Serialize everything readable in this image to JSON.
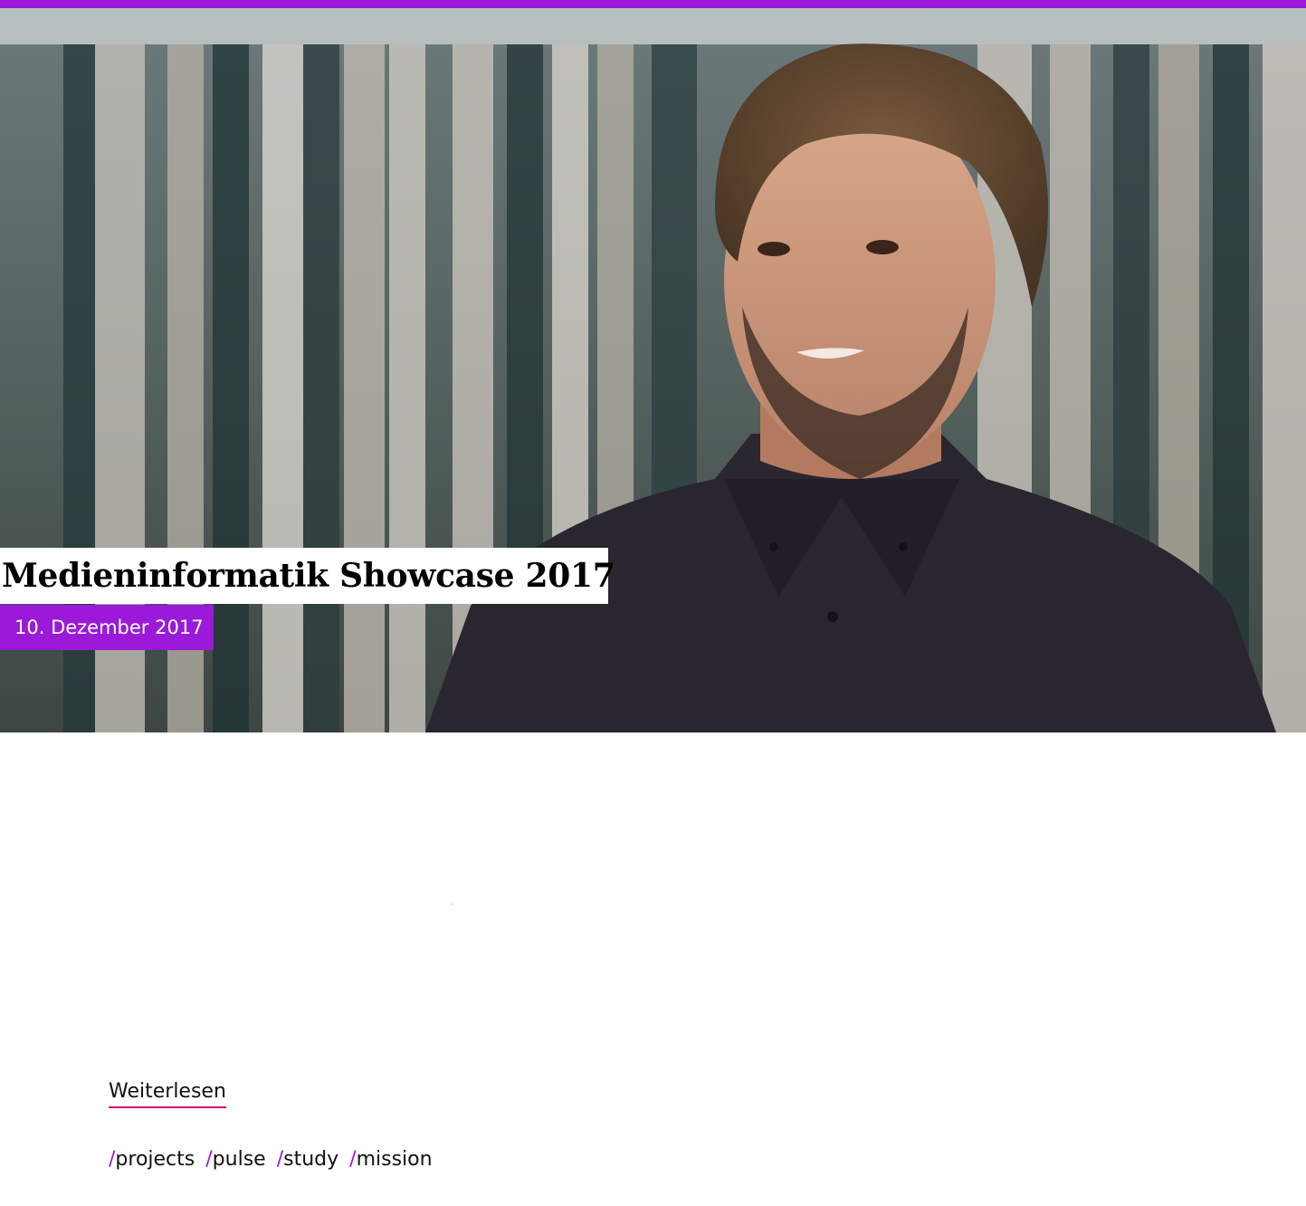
{
  "hero": {
    "title": "Medieninformatik Showcase 2017",
    "date": "10. Dezember 2017",
    "image": "portrait-photo"
  },
  "article": {
    "read_more_label": "Weiterlesen"
  },
  "tags": [
    {
      "slash": "/",
      "label": "projects"
    },
    {
      "slash": "/",
      "label": "pulse"
    },
    {
      "slash": "/",
      "label": "study"
    },
    {
      "slash": "/",
      "label": "mission"
    }
  ],
  "colors": {
    "accent": "#9b19d8",
    "underline": "#c8177a",
    "text": "#111111",
    "background": "#ffffff"
  }
}
